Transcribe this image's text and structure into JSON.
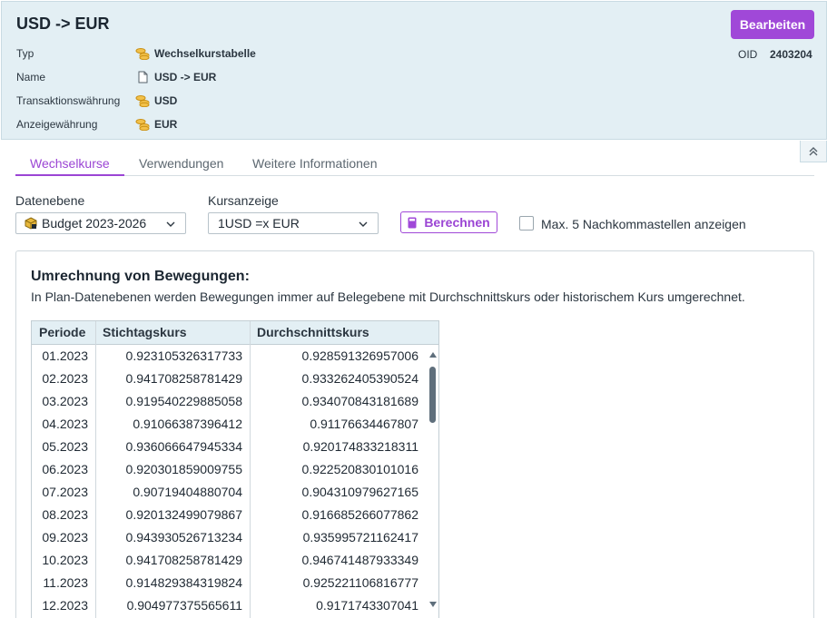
{
  "header": {
    "title": "USD -> EUR",
    "edit_label": "Bearbeiten",
    "oid_label": "OID",
    "oid_value": "2403204",
    "meta": [
      {
        "label": "Typ",
        "value": "Wechselkurstabelle",
        "icon": "coins-icon"
      },
      {
        "label": "Name",
        "value": "USD -> EUR",
        "icon": "document-icon"
      },
      {
        "label": "Transaktionswährung",
        "value": "USD",
        "icon": "coins-icon"
      },
      {
        "label": "Anzeigewährung",
        "value": "EUR",
        "icon": "coins-icon"
      }
    ]
  },
  "tabs": [
    {
      "label": "Wechselkurse",
      "active": true
    },
    {
      "label": "Verwendungen",
      "active": false
    },
    {
      "label": "Weitere Informationen",
      "active": false
    }
  ],
  "controls": {
    "datenebene_label": "Datenebene",
    "datenebene_value": "Budget 2023-2026",
    "kursanzeige_label": "Kursanzeige",
    "kursanzeige_value": "1USD =x EUR",
    "calc_label": "Berechnen",
    "checkbox_label": "Max. 5 Nachkommastellen anzeigen",
    "checkbox_checked": false
  },
  "panel": {
    "title": "Umrechnung von Bewegungen:",
    "description": "In Plan-Datenebenen werden Bewegungen immer auf Belegebene mit Durchschnittskurs oder historischem Kurs umgerechnet."
  },
  "table": {
    "columns": [
      "Periode",
      "Stichtagskurs",
      "Durchschnittskurs"
    ],
    "rows": [
      [
        "01.2023",
        "0.923105326317733",
        "0.928591326957006"
      ],
      [
        "02.2023",
        "0.941708258781429",
        "0.933262405390524"
      ],
      [
        "03.2023",
        "0.919540229885058",
        "0.934070843181689"
      ],
      [
        "04.2023",
        "0.91066387396412",
        "0.91176634467807"
      ],
      [
        "05.2023",
        "0.936066647945334",
        "0.920174833218311"
      ],
      [
        "06.2023",
        "0.920301859009755",
        "0.922520830101016"
      ],
      [
        "07.2023",
        "0.90719404880704",
        "0.904310979627165"
      ],
      [
        "08.2023",
        "0.920132499079867",
        "0.916685266077862"
      ],
      [
        "09.2023",
        "0.943930526713234",
        "0.935995721162417"
      ],
      [
        "10.2023",
        "0.941708258781429",
        "0.946741487933349"
      ],
      [
        "11.2023",
        "0.914829384319824",
        "0.925221106816777"
      ],
      [
        "12.2023",
        "0.904977375565611",
        "0.9171743307041"
      ]
    ]
  },
  "colors": {
    "accent": "#a048d8",
    "header_bg": "#e3eff4"
  }
}
